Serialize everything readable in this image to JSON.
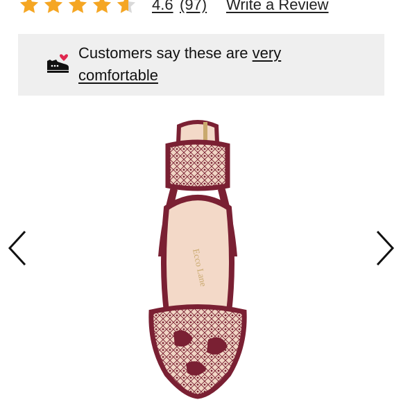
{
  "rating": {
    "value": "4.6",
    "count": "(97)",
    "write_review": "Write a Review",
    "stars_filled": 4.6,
    "star_color": "#f5a623",
    "star_empty_color": "#d9d9d9"
  },
  "promo": {
    "prefix": "Customers say these are ",
    "highlight_line1": "very",
    "highlight_line2": "comfortable",
    "icon": "sneaker-heart-icon",
    "icon_heart_color": "#e0284f"
  },
  "gallery": {
    "product_colors": {
      "suede": "#7a2033",
      "lining": "#f3d9c8"
    },
    "prev_icon": "chevron-left-icon",
    "next_icon": "chevron-right-icon"
  }
}
